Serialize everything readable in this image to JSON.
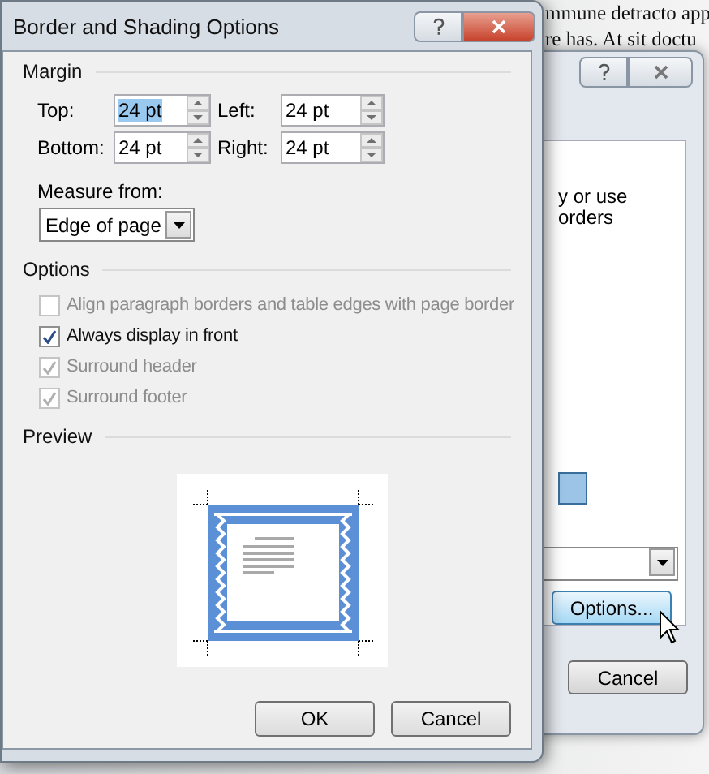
{
  "document": {
    "lines": [
      "mmune detracto app",
      "re has. At sit doctu"
    ]
  },
  "back_dialog": {
    "text_lines": [
      "y or use",
      "orders"
    ],
    "buttons": [
      {
        "label": "Options...",
        "hovered": true
      },
      {
        "label": "Cancel",
        "hovered": false
      }
    ]
  },
  "dialog": {
    "title": "Border and Shading Options",
    "margin": {
      "label": "Margin",
      "fields": [
        {
          "label": "Top:",
          "value": "24 pt",
          "selected": true
        },
        {
          "label": "Left:",
          "value": "24 pt",
          "selected": false
        },
        {
          "label": "Bottom:",
          "value": "24 pt",
          "selected": false
        },
        {
          "label": "Right:",
          "value": "24 pt",
          "selected": false
        }
      ]
    },
    "measure_from": {
      "label": "Measure from:",
      "value": "Edge of page"
    },
    "options": {
      "label": "Options",
      "items": [
        {
          "label": "Align paragraph borders and table edges with page border",
          "checked": false,
          "disabled": true
        },
        {
          "label": "Always display in front",
          "checked": true,
          "disabled": false
        },
        {
          "label": "Surround header",
          "checked": true,
          "disabled": true
        },
        {
          "label": "Surround footer",
          "checked": true,
          "disabled": true
        }
      ]
    },
    "preview": {
      "label": "Preview"
    },
    "buttons": [
      "OK",
      "Cancel"
    ]
  }
}
